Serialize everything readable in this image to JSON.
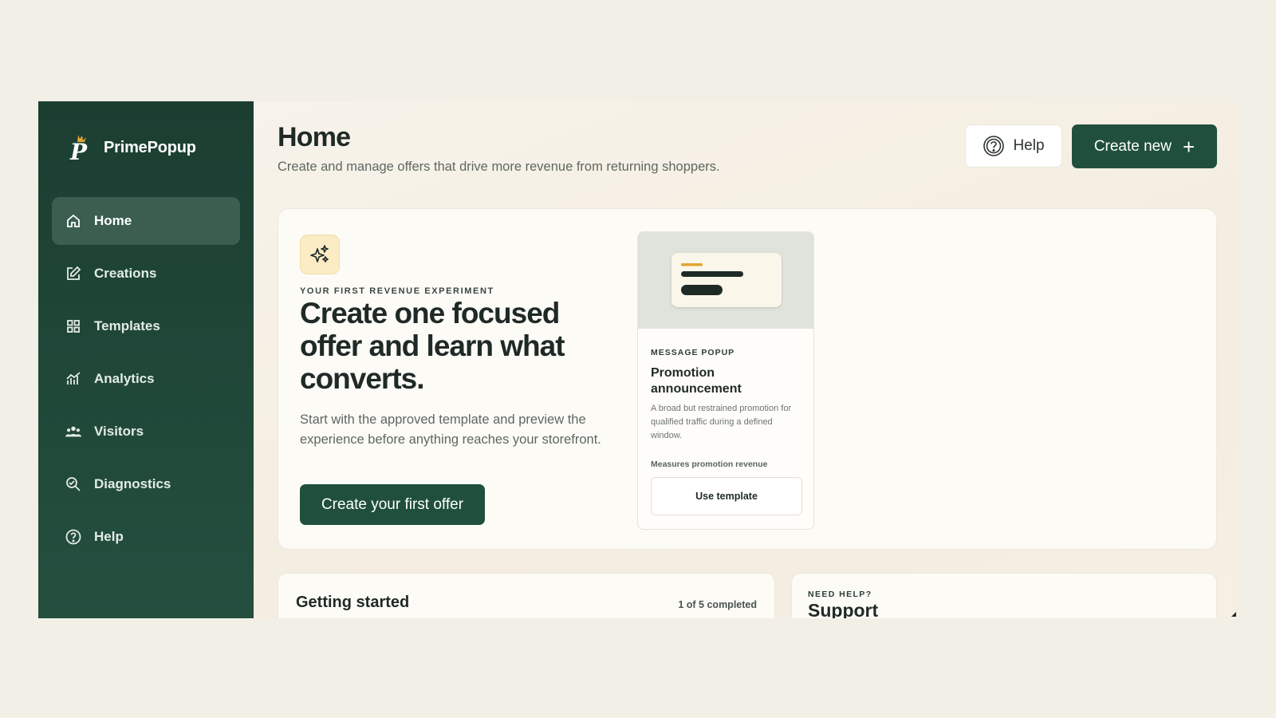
{
  "app": {
    "brand_name": "PrimePopup"
  },
  "sidebar": {
    "items": [
      {
        "label": "Home",
        "icon": "home-icon",
        "active": true
      },
      {
        "label": "Creations",
        "icon": "edit-icon"
      },
      {
        "label": "Templates",
        "icon": "grid-icon"
      },
      {
        "label": "Analytics",
        "icon": "analytics-icon"
      },
      {
        "label": "Visitors",
        "icon": "users-icon"
      },
      {
        "label": "Diagnostics",
        "icon": "search-diagnostics-icon"
      },
      {
        "label": "Help",
        "icon": "help-circle-icon"
      }
    ]
  },
  "header": {
    "title": "Home",
    "subtitle": "Create and manage offers that drive more revenue from returning shoppers.",
    "help_label": "Help",
    "create_label": "Create new"
  },
  "hero": {
    "eyebrow": "YOUR FIRST REVENUE EXPERIMENT",
    "title": "Create one focused offer and learn what converts.",
    "body": "Start with the approved template and preview the experience before anything reaches your storefront.",
    "cta_label": "Create your first offer",
    "template": {
      "kicker": "MESSAGE POPUP",
      "title": "Promotion announcement",
      "description": "A broad but restrained promotion for qualified traffic during a defined window.",
      "measures": "Measures promotion revenue",
      "button_label": "Use template"
    }
  },
  "getting_started": {
    "title": "Getting started",
    "progress": "1 of 5 completed"
  },
  "support": {
    "kicker": "NEED HELP?",
    "title": "Support"
  },
  "colors": {
    "sidebar": "#1b3e31",
    "accent": "#20503d",
    "gold": "#e0a634",
    "background": "#f2efe6"
  }
}
